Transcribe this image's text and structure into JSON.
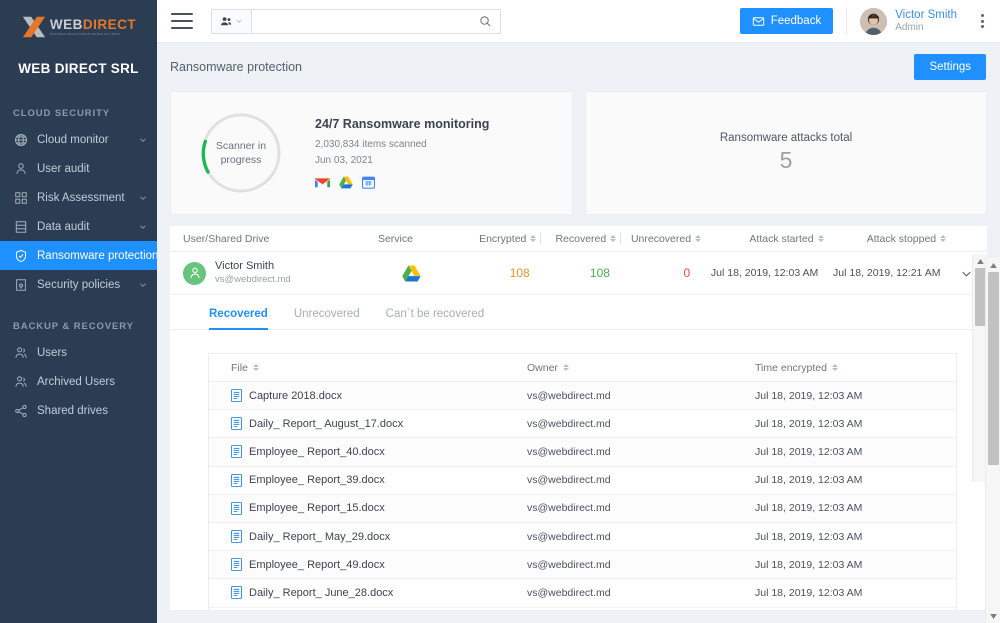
{
  "brand": {
    "logo_web": "WEB",
    "logo_direct": "DIRECT",
    "logo_tagline": "BUSINESS RELATIONSHIP BASED ON TRUST",
    "org_name": "WEB DIRECT SRL",
    "accent_color": "#1e90ff",
    "sidebar_color": "#2b3d52"
  },
  "sidebar": {
    "sections": [
      {
        "title": "CLOUD SECURITY",
        "items": [
          {
            "label": "Cloud monitor",
            "icon": "globe-icon",
            "caret": true,
            "active": false
          },
          {
            "label": "User audit",
            "icon": "person-icon",
            "caret": false,
            "active": false
          },
          {
            "label": "Risk Assessment",
            "icon": "grid-icon",
            "caret": true,
            "active": false
          },
          {
            "label": "Data audit",
            "icon": "database-icon",
            "caret": true,
            "active": false
          },
          {
            "label": "Ransomware protection",
            "icon": "shield-check-icon",
            "caret": false,
            "active": true
          },
          {
            "label": "Security policies",
            "icon": "policy-icon",
            "caret": true,
            "active": false
          }
        ]
      },
      {
        "title": "BACKUP & RECOVERY",
        "items": [
          {
            "label": "Users",
            "icon": "users-icon",
            "caret": false,
            "active": false
          },
          {
            "label": "Archived Users",
            "icon": "archived-users-icon",
            "caret": false,
            "active": false
          },
          {
            "label": "Shared drives",
            "icon": "share-icon",
            "caret": false,
            "active": false
          }
        ]
      }
    ]
  },
  "topbar": {
    "search_value": "",
    "search_placeholder": "",
    "scope_icon": "people-icon",
    "feedback_label": "Feedback",
    "user_name": "Victor Smith",
    "user_role": "Admin"
  },
  "page": {
    "title": "Ransomware protection",
    "settings_label": "Settings"
  },
  "scanner_card": {
    "donut_label_line1": "Scanner in",
    "donut_label_line2": "progress",
    "progress_percent": 25,
    "ring_color": "#e0e0e0",
    "progress_color": "#1db954",
    "title": "24/7 Ransomware monitoring",
    "items_scanned": "2,030,834 items scanned",
    "date": "Jun 03, 2021",
    "services": [
      "gmail-icon",
      "google-drive-icon",
      "google-calendar-icon"
    ]
  },
  "attacks_card": {
    "title": "Ransomware attacks total",
    "count": "5"
  },
  "outer_table": {
    "columns": [
      {
        "label": "User/Shared Drive",
        "sortable": false
      },
      {
        "label": "Service",
        "sortable": false
      },
      {
        "label": "Encrypted",
        "sortable": true
      },
      {
        "label": "Recovered",
        "sortable": true
      },
      {
        "label": "Unrecovered",
        "sortable": true
      },
      {
        "label": "Attack started",
        "sortable": true
      },
      {
        "label": "Attack stopped",
        "sortable": true
      }
    ],
    "rows": [
      {
        "user_name": "Victor Smith",
        "user_email": "vs@webdirect.md",
        "service": "google-drive-icon",
        "encrypted": "108",
        "recovered": "108",
        "unrecovered": "0",
        "attack_started": "Jul 18, 2019, 12:03 AM",
        "attack_stopped": "Jul 18, 2019, 12:21 AM",
        "expanded": true
      }
    ]
  },
  "detail_tabs": [
    {
      "label": "Recovered",
      "active": true
    },
    {
      "label": "Unrecovered",
      "active": false
    },
    {
      "label": "Can`t be recovered",
      "active": false
    }
  ],
  "inner_table": {
    "columns": [
      {
        "label": "File",
        "sortable": true
      },
      {
        "label": "Owner",
        "sortable": true
      },
      {
        "label": "Time encrypted",
        "sortable": true
      }
    ],
    "rows": [
      {
        "file": "Capture 2018.docx",
        "owner": "vs@webdirect.md",
        "time": "Jul 18, 2019, 12:03 AM"
      },
      {
        "file": "Daily_ Report_ August_17.docx",
        "owner": "vs@webdirect.md",
        "time": "Jul 18, 2019, 12:03 AM"
      },
      {
        "file": "Employee_ Report_40.docx",
        "owner": "vs@webdirect.md",
        "time": "Jul 18, 2019, 12:03 AM"
      },
      {
        "file": "Employee_ Report_39.docx",
        "owner": "vs@webdirect.md",
        "time": "Jul 18, 2019, 12:03 AM"
      },
      {
        "file": "Employee_ Report_15.docx",
        "owner": "vs@webdirect.md",
        "time": "Jul 18, 2019, 12:03 AM"
      },
      {
        "file": "Daily_ Report_ May_29.docx",
        "owner": "vs@webdirect.md",
        "time": "Jul 18, 2019, 12:03 AM"
      },
      {
        "file": "Employee_ Report_49.docx",
        "owner": "vs@webdirect.md",
        "time": "Jul 18, 2019, 12:03 AM"
      },
      {
        "file": "Daily_ Report_ June_28.docx",
        "owner": "vs@webdirect.md",
        "time": "Jul 18, 2019, 12:03 AM"
      }
    ]
  },
  "annotation": {
    "arrow_color": "#ec2227",
    "points_to": "expand-row-chevron"
  }
}
